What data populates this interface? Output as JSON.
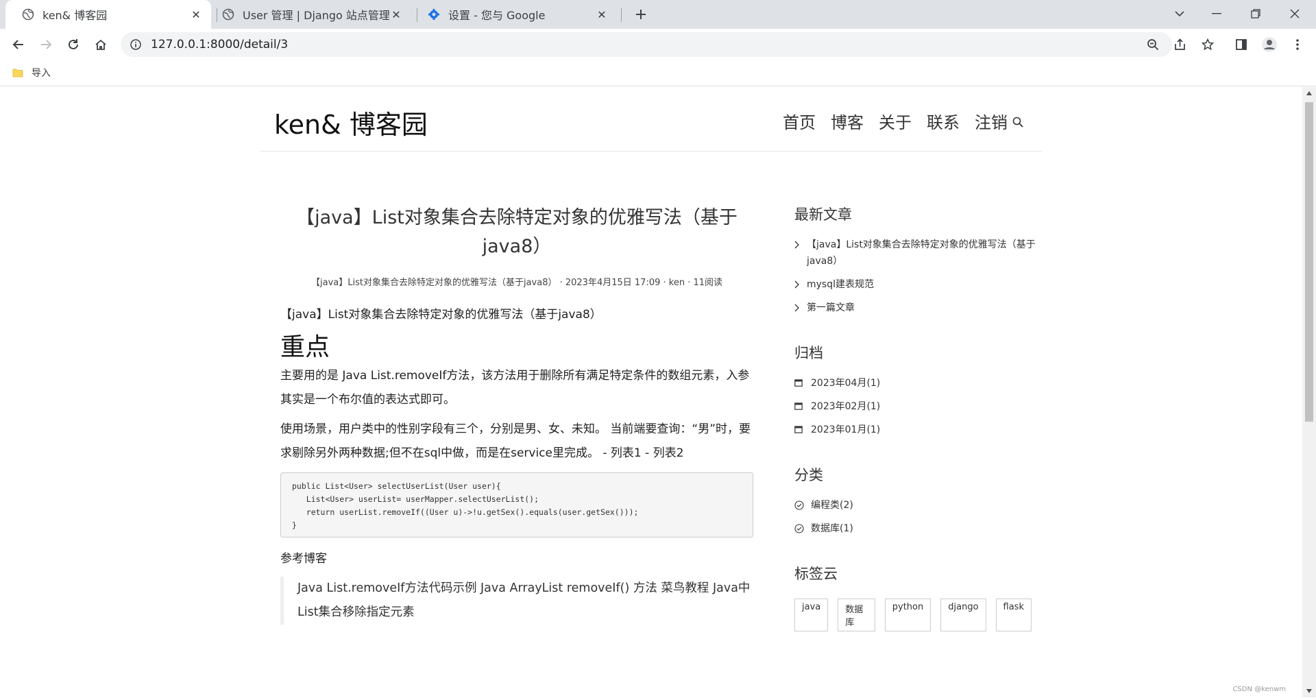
{
  "browser": {
    "tabs": [
      {
        "title": "ken& 博客园",
        "active": true
      },
      {
        "title": "User 管理 | Django 站点管理员",
        "active": false
      },
      {
        "title": "设置 - 您与 Google",
        "active": false
      }
    ],
    "url": "127.0.0.1:8000/detail/3",
    "bookmark": "导入"
  },
  "site": {
    "logo": "ken& 博客园",
    "nav": [
      "首页",
      "博客",
      "关于",
      "联系",
      "注销"
    ]
  },
  "article": {
    "title": "【java】List对象集合去除特定对象的优雅写法（基于java8）",
    "meta": "【java】List对象集合去除特定对象的优雅写法（基于java8） · 2023年4月15日 17:09 · ken · 11阅读",
    "subtitle": "【java】List对象集合去除特定对象的优雅写法（基于java8）",
    "heading": "重点",
    "para1": "主要用的是 Java List.removeIf方法，该方法用于删除所有满足特定条件的数组元素，入参其实是一个布尔值的表达式即可。",
    "para2": "使用场景，用户类中的性别字段有三个，分别是男、女、未知。 当前端要查询：“男”时，要求剔除另外两种数据;但不在sql中做，而是在service里完成。 - 列表1 - 列表2",
    "code": "public List<User> selectUserList(User user){\n   List<User> userList= userMapper.selectUserList();\n   return userList.removeIf((User u)->!u.getSex().equals(user.getSex()));\n}",
    "ref_heading": "参考博客",
    "quote": "Java List.removeIf方法代码示例 Java ArrayList removeIf() 方法 菜鸟教程 Java中List集合移除指定元素"
  },
  "sidebar": {
    "recent_title": "最新文章",
    "recent": [
      "【java】List对象集合去除特定对象的优雅写法（基于java8）",
      "mysql建表规范",
      "第一篇文章"
    ],
    "archive_title": "归档",
    "archive": [
      "2023年04月(1)",
      "2023年02月(1)",
      "2023年01月(1)"
    ],
    "category_title": "分类",
    "categories": [
      "编程类(2)",
      "数据库(1)"
    ],
    "tags_title": "标签云",
    "tags": [
      "java",
      "数据库",
      "python",
      "django",
      "flask"
    ]
  },
  "watermark": "CSDN @kenwm"
}
